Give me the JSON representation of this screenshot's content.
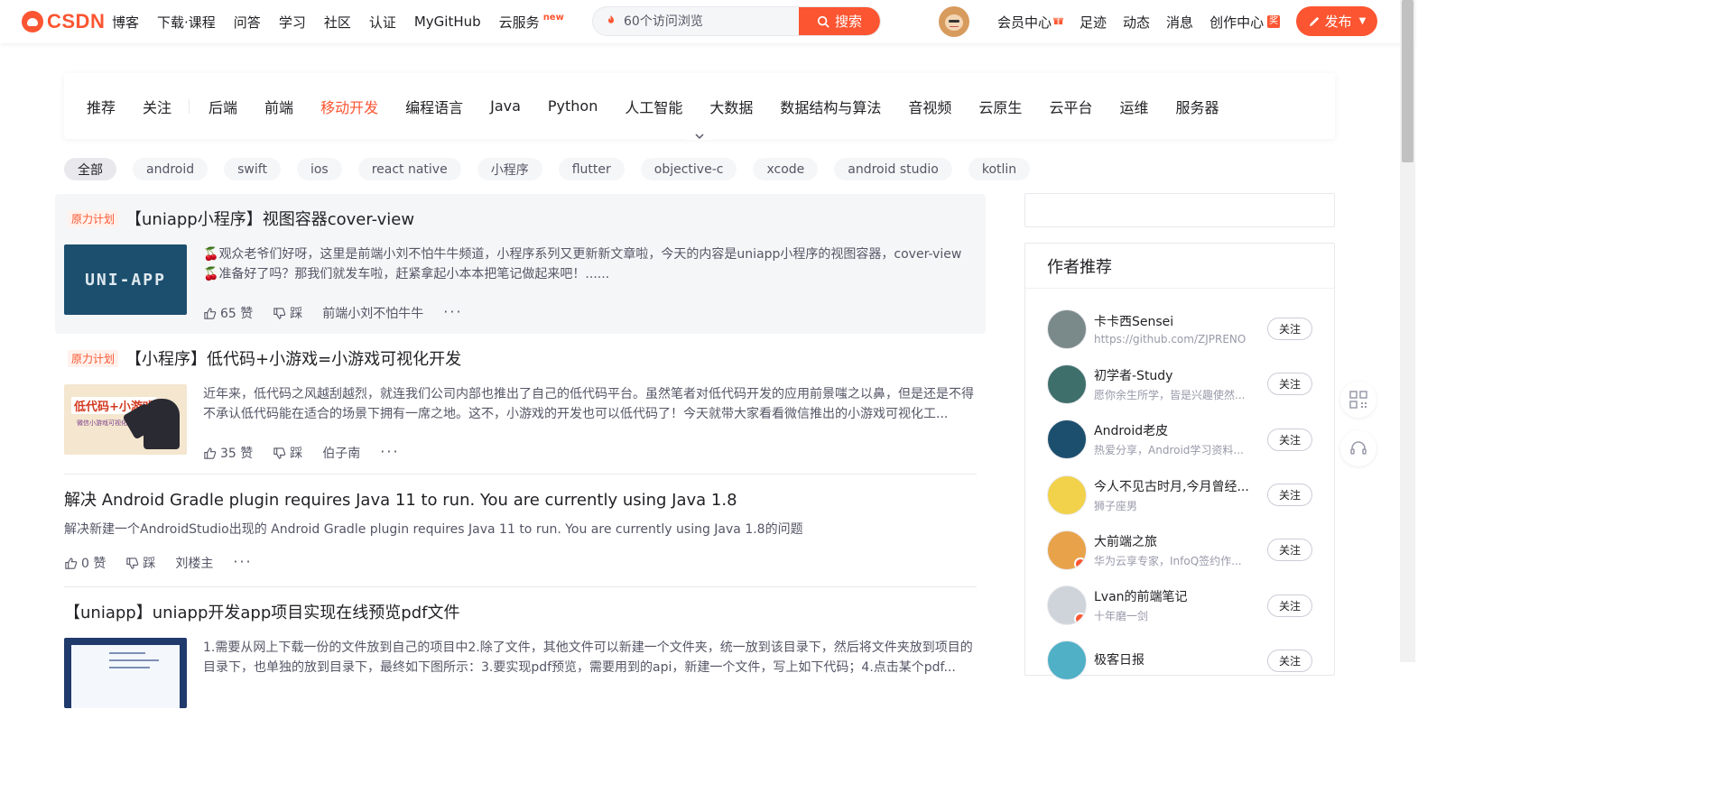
{
  "header": {
    "logo_text": "CSDN",
    "nav": [
      "博客",
      "下载·课程",
      "问答",
      "学习",
      "社区",
      "认证",
      "MyGitHub",
      "云服务"
    ],
    "new_badge": "new",
    "search": {
      "placeholder": "60个访问浏览",
      "button_label": "搜索"
    },
    "right_nav": [
      "会员中心",
      "足迹",
      "动态",
      "消息",
      "创作中心"
    ],
    "create_badge": "奖",
    "publish_label": "发布"
  },
  "categories": {
    "items": [
      "推荐",
      "关注",
      "后端",
      "前端",
      "移动开发",
      "编程语言",
      "Java",
      "Python",
      "人工智能",
      "大数据",
      "数据结构与算法",
      "音视频",
      "云原生",
      "云平台",
      "运维",
      "服务器"
    ],
    "active": "移动开发"
  },
  "tags": {
    "items": [
      "全部",
      "android",
      "swift",
      "ios",
      "react native",
      "小程序",
      "flutter",
      "objective-c",
      "xcode",
      "android studio",
      "kotlin"
    ],
    "active": "全部"
  },
  "articles": [
    {
      "badge": "原力计划",
      "title": "【uniapp小程序】视图容器cover-view",
      "thumb_text": "UNI-APP",
      "desc_line1": "观众老爷们好呀，这里是前端小刘不怕牛牛频道，小程序系列又更新新文章啦，今天的内容是uniapp小程序的视图容器，cover-view",
      "desc_line2": "准备好了吗？那我们就发车啦，赶紧拿起小本本把笔记做起来吧！......",
      "likes": "65 赞",
      "dislike": "踩",
      "author": "前端小刘不怕牛牛",
      "more": "···"
    },
    {
      "badge": "原力计划",
      "title": "【小程序】低代码+小游戏=小游戏可视化开发",
      "thumb_text": "低代码+小游戏",
      "thumb_sub": "微信小游戏可视化开发",
      "desc": "近年来，低代码之风越刮越烈，就连我们公司内部也推出了自己的低代码平台。虽然笔者对低代码开发的应用前景嗤之以鼻，但是还是不得不承认低代码能在适合的场景下拥有一席之地。这不，小游戏的开发也可以低代码了！今天就带大家看看微信推出的小游戏可视化工...",
      "likes": "35 赞",
      "dislike": "踩",
      "author": "伯子南",
      "more": "···"
    },
    {
      "title": "解决 Android Gradle plugin requires Java 11 to run. You are currently using Java 1.8",
      "desc": "解决新建一个AndroidStudio出现的 Android Gradle plugin requires Java 11 to run. You are currently using Java 1.8的问题",
      "likes": "0 赞",
      "dislike": "踩",
      "author": "刘楼主",
      "more": "···"
    },
    {
      "title": "【uniapp】uniapp开发app项目实现在线预览pdf文件",
      "desc": "1.需要从网上下载一份的文件放到自己的项目中2.除了文件，其他文件可以新建一个文件夹，统一放到该目录下，然后将文件夹放到项目的目录下，也单独的放到目录下，最终如下图所示：3.要实现pdf预览，需要用到的api，新建一个文件，写上如下代码；4.点击某个pdf..."
    }
  ],
  "sidebar": {
    "author_title": "作者推荐",
    "follow_label": "关注",
    "authors": [
      {
        "name": "卡卡西Sensei",
        "bio": "https://github.com/ZJPRENO",
        "avatar_color": "#7a8a8a"
      },
      {
        "name": "初学者-Study",
        "bio": "愿你余生所学，皆是兴趣使然...",
        "avatar_color": "#3f6f6a"
      },
      {
        "name": "Android老皮",
        "bio": "热爱分享，Android学习资料...",
        "avatar_color": "#1c4f6e"
      },
      {
        "name": "今人不见古时月,今月曾经...",
        "bio": "狮子座男",
        "avatar_color": "#f2d24a"
      },
      {
        "name": "大前端之旅",
        "bio": "华为云享专家，InfoQ签约作...",
        "avatar_color": "#e8a34a"
      },
      {
        "name": "Lvan的前端笔记",
        "bio": "十年磨一剑",
        "avatar_color": "#cfd4da"
      },
      {
        "name": "极客日报",
        "bio": "",
        "avatar_color": "#4fb0c6"
      }
    ]
  },
  "colors": {
    "accent": "#fc5531",
    "text": "#222226",
    "muted": "#555666"
  }
}
